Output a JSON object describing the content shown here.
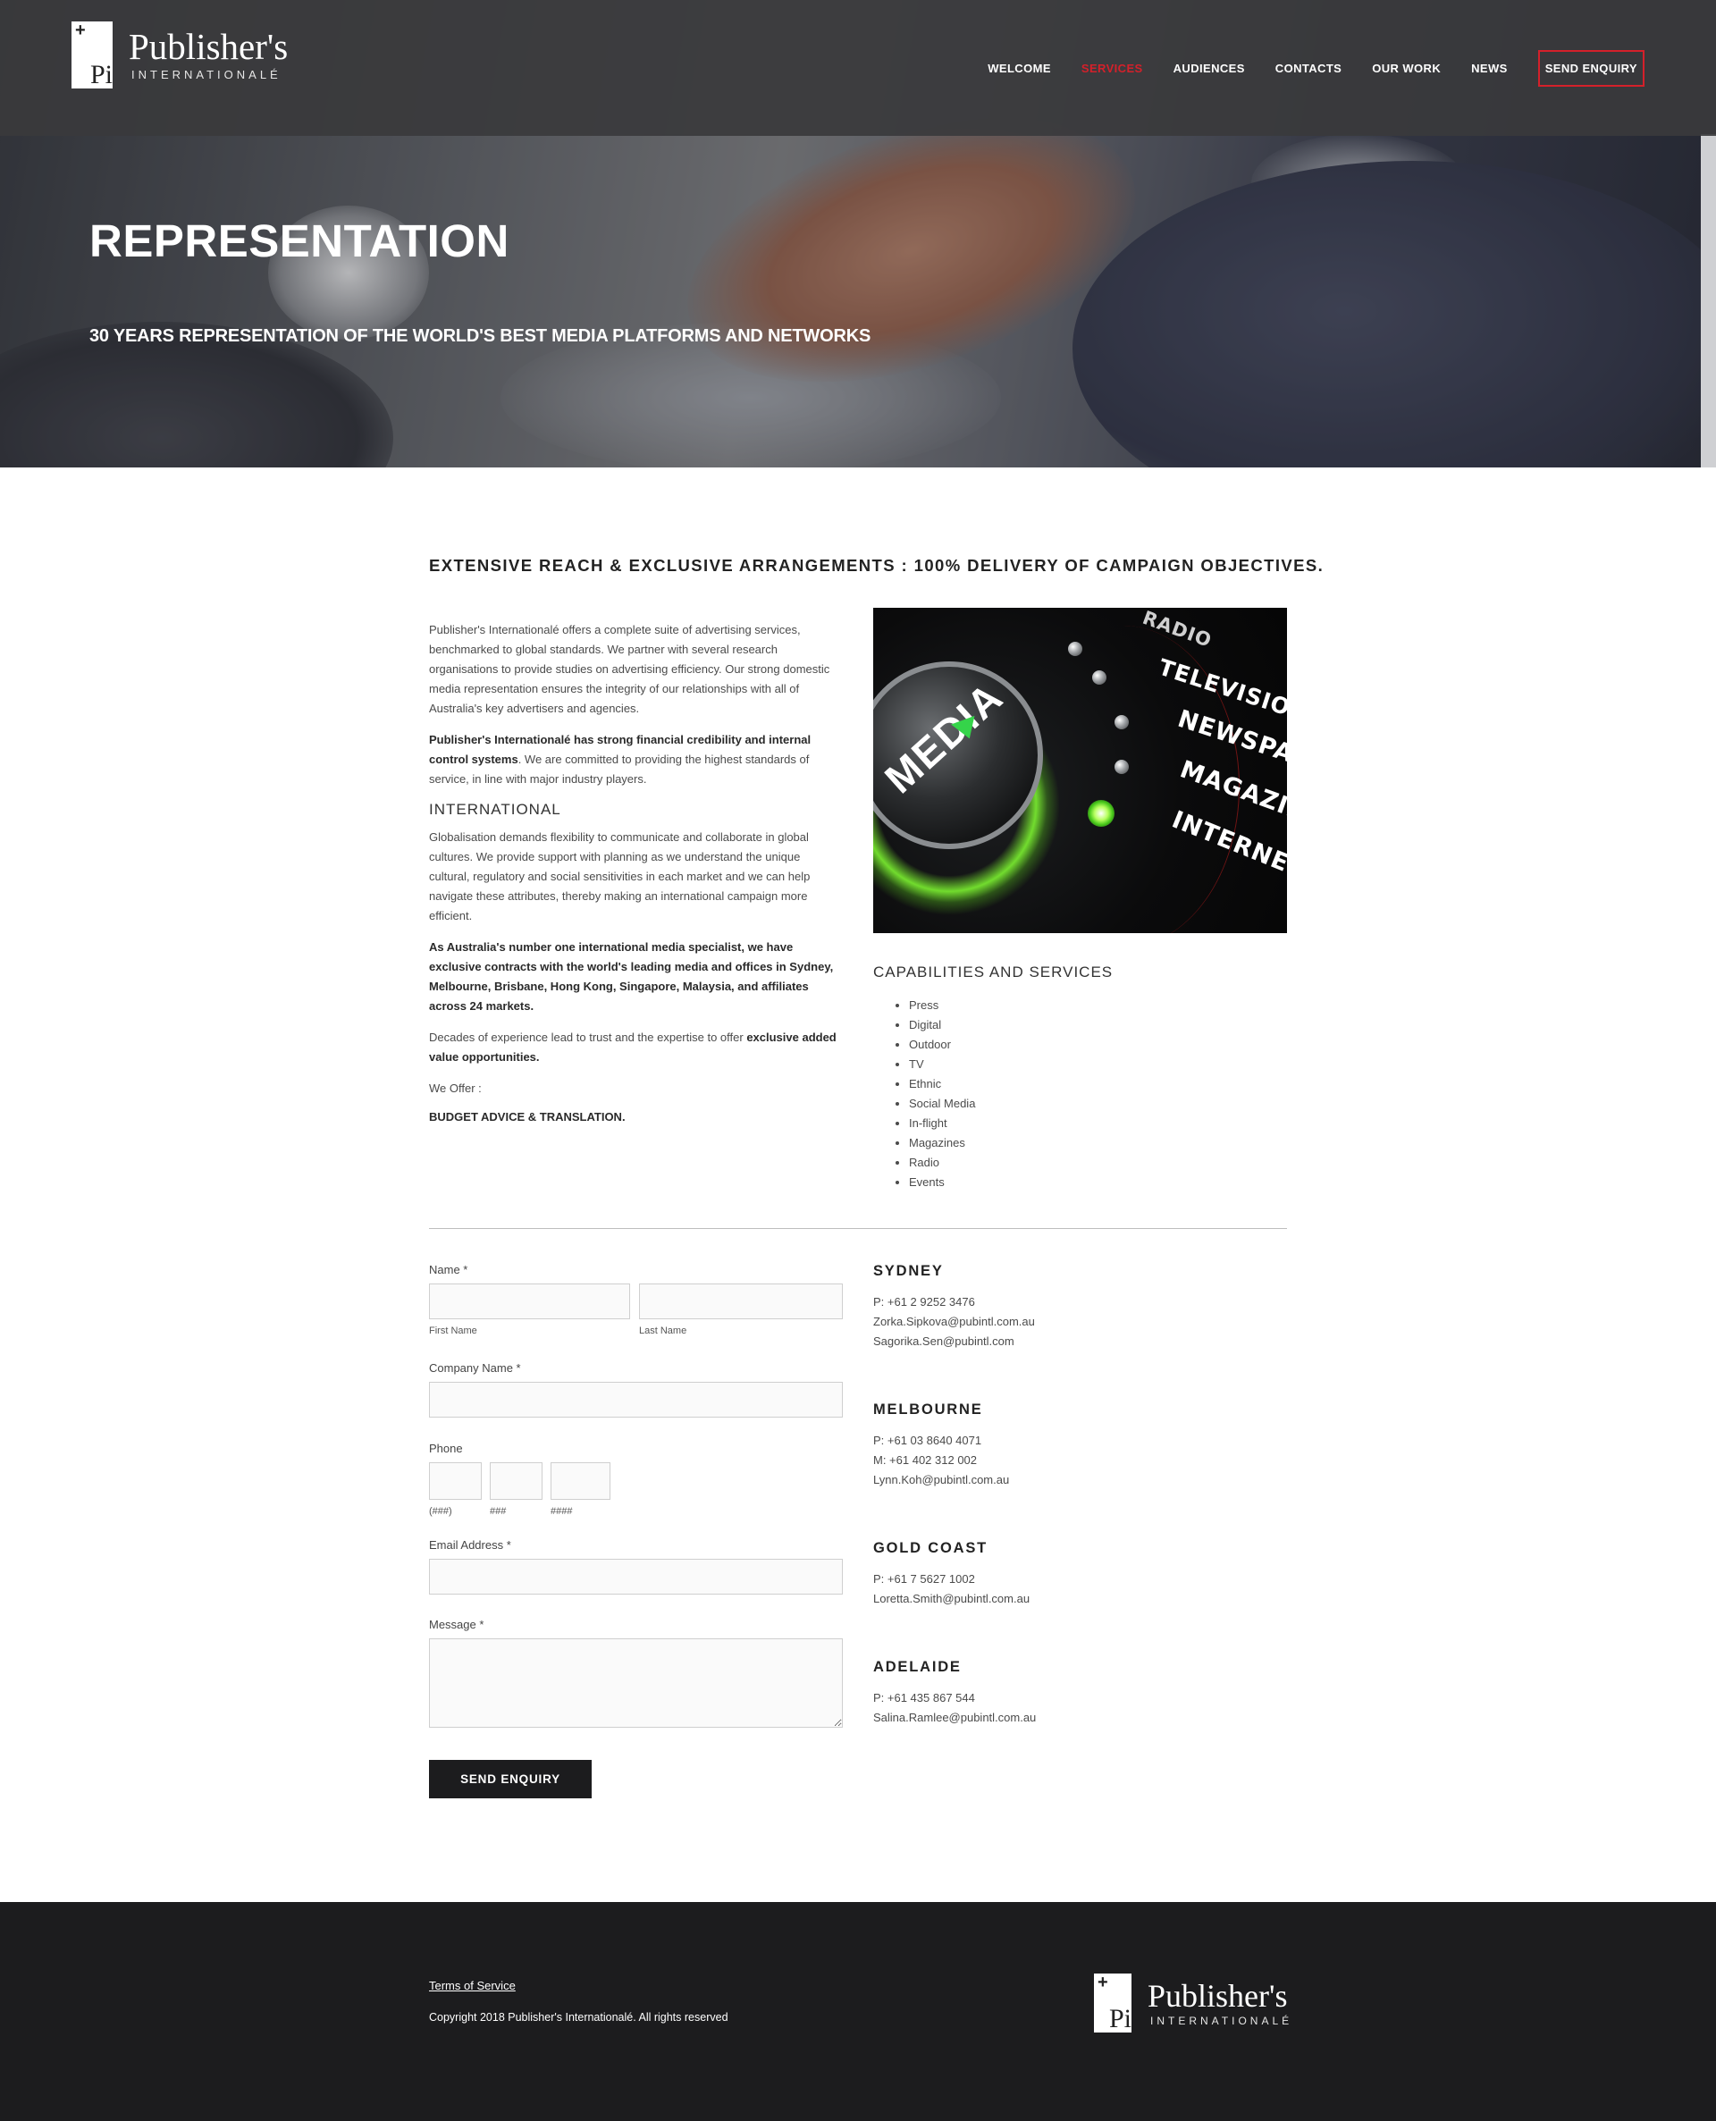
{
  "brand": {
    "name": "Publisher's",
    "subtitle": "INTERNATIONALÉ",
    "mark_plus": "+",
    "mark_pi": "Pi"
  },
  "nav": {
    "items": [
      "WELCOME",
      "SERVICES",
      "AUDIENCES",
      "CONTACTS",
      "OUR WORK",
      "NEWS"
    ],
    "active": "SERVICES",
    "cta": "SEND ENQUIRY"
  },
  "colors": {
    "accent": "#d4202a",
    "dark": "#1c1c1e",
    "glow": "#7dff2e"
  },
  "hero": {
    "title": "REPRESENTATION",
    "subtitle": "30 YEARS REPRESENTATION OF THE WORLD'S BEST MEDIA PLATFORMS AND NETWORKS"
  },
  "headline": "EXTENSIVE REACH & EXCLUSIVE ARRANGEMENTS : 100% DELIVERY OF CAMPAIGN OBJECTIVES.",
  "content": {
    "p1": "Publisher's Internationalé offers a complete suite of advertising services, benchmarked to global standards. We partner with several research organisations to provide studies on advertising efficiency. Our strong domestic media representation ensures the integrity of our relationships with all of Australia's key advertisers and agencies.",
    "p2_bold": "Publisher's Internationalé has strong financial credibility and internal control systems",
    "p2_rest": ". We are committed to providing the highest standards of service, in line with major industry players.",
    "international_heading": "INTERNATIONAL",
    "p3": "Globalisation demands flexibility to communicate and collaborate in global cultures. We provide support with planning as we understand the unique cultural, regulatory and social sensitivities in each market and we can help navigate these attributes, thereby making an international campaign more efficient.",
    "p4": "As Australia's number one international media specialist, we have exclusive contracts with the world's leading media and offices in Sydney, Melbourne, Brisbane, Hong Kong, Singapore, Malaysia, and affiliates across 24 markets.",
    "p5_text": "Decades of experience lead to trust and the expertise to offer ",
    "p5_bold": "exclusive added value opportunities.",
    "we_offer": "We Offer :",
    "offer": "BUDGET ADVICE & TRANSLATION."
  },
  "media_image": {
    "knob_label": "MEDIA",
    "dial_labels": [
      "RADIO",
      "TELEVISION",
      "NEWSPAP",
      "MAGAZIN",
      "INTERNET"
    ],
    "icon": "media-knob-illustration"
  },
  "capabilities": {
    "title": "CAPABILITIES AND SERVICES",
    "items": [
      "Press",
      "Digital",
      "Outdoor",
      "TV",
      "Ethnic",
      "Social Media",
      "In-flight",
      "Magazines",
      "Radio",
      "Events"
    ]
  },
  "form": {
    "name_label": "Name *",
    "first_name": "First Name",
    "last_name": "Last Name",
    "company_label": "Company Name *",
    "phone_label": "Phone",
    "phone_parts": [
      "(###)",
      "###",
      "####"
    ],
    "email_label": "Email Address *",
    "message_label": "Message *",
    "submit": "SEND ENQUIRY"
  },
  "offices": [
    {
      "city": "SYDNEY",
      "lines": [
        "P: +61 2 9252 3476",
        "Zorka.Sipkova@pubintl.com.au",
        "Sagorika.Sen@pubintl.com"
      ]
    },
    {
      "city": "MELBOURNE",
      "lines": [
        "P: +61 03 8640 4071",
        "M: +61 402 312 002",
        "Lynn.Koh@pubintl.com.au"
      ]
    },
    {
      "city": "GOLD COAST",
      "lines": [
        "P: +61 7 5627 1002",
        "Loretta.Smith@pubintl.com.au"
      ]
    },
    {
      "city": "ADELAIDE",
      "lines": [
        "P: +61 435 867 544",
        "Salina.Ramlee@pubintl.com.au"
      ]
    }
  ],
  "footer": {
    "terms": "Terms of Service",
    "copyright": "Copyright 2018 Publisher's Internationalé. All rights reserved"
  }
}
